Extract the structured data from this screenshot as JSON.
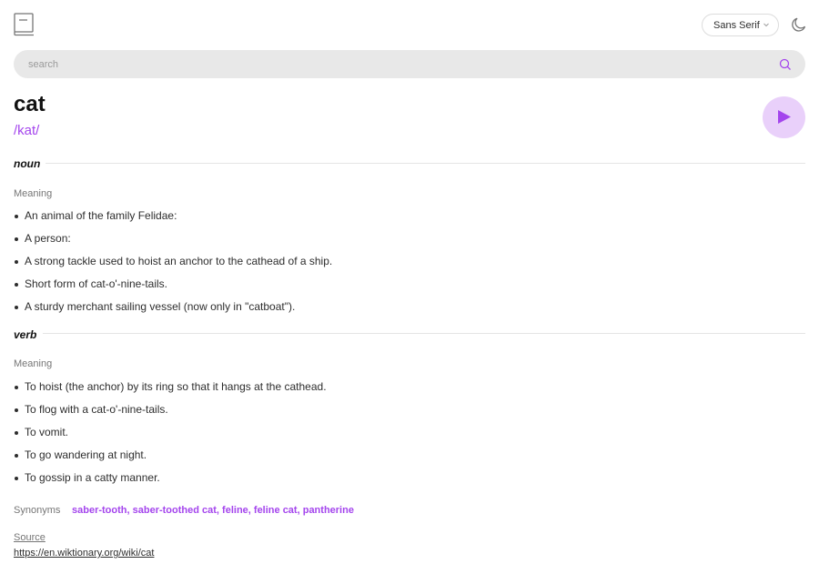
{
  "header": {
    "logo_icon": "book-icon",
    "font_selected": "Sans Serif",
    "theme_icon": "moon-icon"
  },
  "search": {
    "placeholder": "search",
    "value": "",
    "icon": "search-icon"
  },
  "entry": {
    "word": "cat",
    "phonetic": "/kat/",
    "play_icon": "play-icon"
  },
  "meanings": [
    {
      "part_of_speech": "noun",
      "label": "Meaning",
      "definitions": [
        "An animal of the family Felidae:",
        "A person:",
        "A strong tackle used to hoist an anchor to the cathead of a ship.",
        "Short form of cat-o'-nine-tails.",
        "A sturdy merchant sailing vessel (now only in \"catboat\")."
      ]
    },
    {
      "part_of_speech": "verb",
      "label": "Meaning",
      "definitions": [
        "To hoist (the anchor) by its ring so that it hangs at the cathead.",
        "To flog with a cat-o'-nine-tails.",
        "To vomit.",
        "To go wandering at night.",
        "To gossip in a catty manner."
      ]
    }
  ],
  "synonyms": {
    "label": "Synonyms",
    "items": [
      "saber-tooth",
      "saber-toothed cat",
      "feline",
      "feline cat",
      "pantherine"
    ]
  },
  "source": {
    "label": "Source",
    "url": "https://en.wiktionary.org/wiki/cat"
  },
  "colors": {
    "accent": "#a445ed",
    "play_bg": "#e9d0fa",
    "search_bg": "#e8e8e8"
  }
}
